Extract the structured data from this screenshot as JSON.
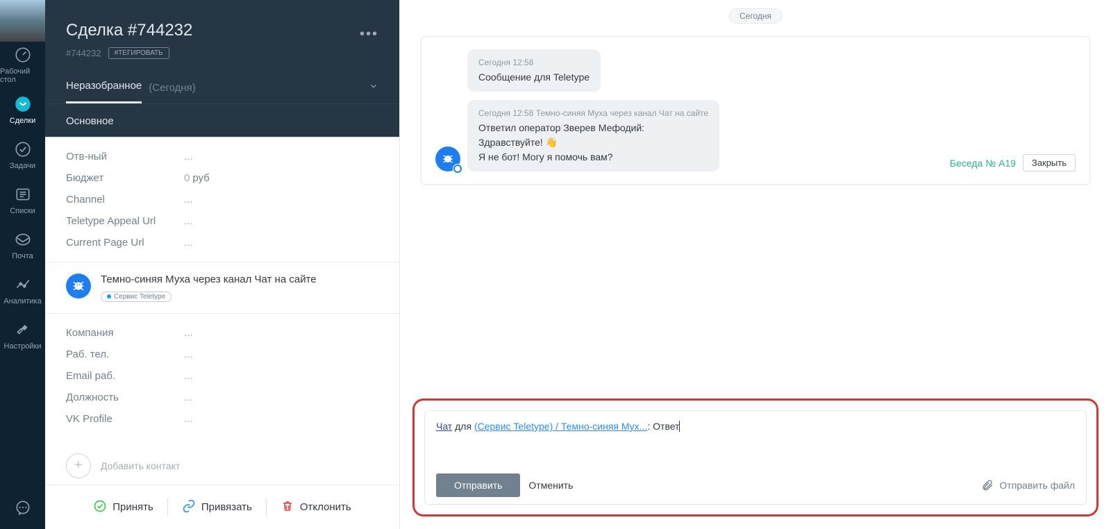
{
  "nav": {
    "items": [
      {
        "label": "Рабочий стол"
      },
      {
        "label": "Сделки"
      },
      {
        "label": "Задачи"
      },
      {
        "label": "Списки"
      },
      {
        "label": "Почта"
      },
      {
        "label": "Аналитика"
      },
      {
        "label": "Настройки"
      }
    ]
  },
  "deal": {
    "title": "Сделка #744232",
    "id": "#744232",
    "tag_button": "#ТЕГИРОВАТЬ",
    "stage_label": "Неразобранное",
    "stage_meta": "(Сегодня)",
    "main_tab": "Основное",
    "fields": {
      "responsible_label": "Отв-ный",
      "responsible_value": "...",
      "budget_label": "Бюджет",
      "budget_value": "0",
      "budget_currency": "руб",
      "channel_label": "Channel",
      "channel_value": "...",
      "appeal_label": "Teletype Appeal Url",
      "appeal_value": "...",
      "page_label": "Current Page Url",
      "page_value": "..."
    },
    "contact": {
      "name": "Темно-синяя Муха через канал Чат на сайте",
      "badge": "Сервис Teletype",
      "fields": {
        "company_label": "Компания",
        "company_value": "...",
        "phone_label": "Раб. тел.",
        "phone_value": "...",
        "email_label": "Email раб.",
        "email_value": "...",
        "position_label": "Должность",
        "position_value": "...",
        "vk_label": "VK Profile",
        "vk_value": "..."
      }
    },
    "add_contact": "Добавить контакт",
    "footer": {
      "accept": "Принять",
      "link": "Привязать",
      "decline": "Отклонить"
    }
  },
  "chat": {
    "date_separator": "Сегодня",
    "messages": [
      {
        "meta": "Сегодня 12:58",
        "text": "Сообщение для Teletype"
      },
      {
        "meta": "Сегодня 12:58 Темно-синяя Муха через канал Чат на сайте",
        "line1": "Ответил оператор Зверев Мефодий:",
        "line2": "Здравствуйте! 👋",
        "line3": "Я не бот! Могу я помочь вам?"
      }
    ],
    "conversation_link": "Беседа № A19",
    "close_button": "Закрыть",
    "compose": {
      "chat_label": "Чат",
      "for_label": " для ",
      "recipient": "(Сервис Teletype) / Темно-синяя Мух...",
      "colon": ": ",
      "typed": "Ответ",
      "send": "Отправить",
      "cancel": "Отменить",
      "attach": "Отправить файл"
    }
  }
}
